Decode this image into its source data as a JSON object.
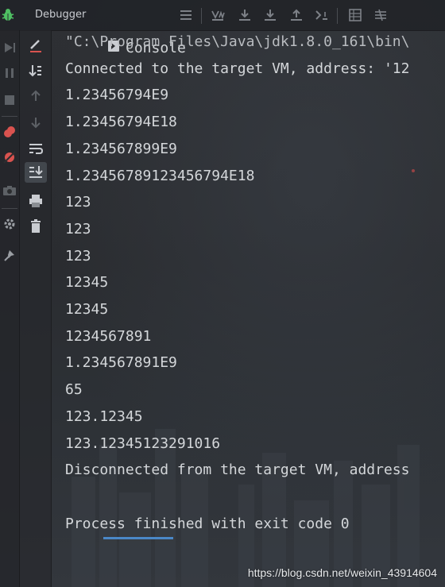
{
  "tabs": {
    "debugger_label": "Debugger",
    "console_label": "Console",
    "active": "Console"
  },
  "toolbar_icons": [
    "menu-icon",
    "show-execution-point-icon",
    "step-over-icon",
    "step-into-icon",
    "step-out-icon",
    "run-to-cursor-icon",
    "evaluate-icon",
    "trace-icon"
  ],
  "left_icons": [
    "rerun-icon",
    "resume-icon",
    "pause-icon",
    "stop-icon",
    "view-breakpoints-icon",
    "mute-breakpoints-icon",
    "camera-icon",
    "settings-icon",
    "pin-icon"
  ],
  "console_icons": [
    "clear-edit-icon",
    "sort-icon",
    "up-icon",
    "down-icon",
    "soft-wrap-icon",
    "scroll-to-end-icon",
    "print-icon",
    "trash-icon"
  ],
  "console": {
    "lines": [
      {
        "text": "\"C:\\Program Files\\Java\\jdk1.8.0_161\\bin\\",
        "kind": "cmd"
      },
      {
        "text": "Connected to the target VM, address: '12",
        "kind": "out"
      },
      {
        "text": "1.23456794E9",
        "kind": "out"
      },
      {
        "text": "1.23456794E18",
        "kind": "out"
      },
      {
        "text": "1.234567899E9",
        "kind": "out"
      },
      {
        "text": "1.2345678912345679 4E18",
        "kind": "out"
      },
      {
        "text": "123",
        "kind": "out"
      },
      {
        "text": "123",
        "kind": "out"
      },
      {
        "text": "123",
        "kind": "out"
      },
      {
        "text": "12345",
        "kind": "out"
      },
      {
        "text": "12345",
        "kind": "out"
      },
      {
        "text": "1234567891",
        "kind": "out"
      },
      {
        "text": "1.234567891E9",
        "kind": "out"
      },
      {
        "text": "65",
        "kind": "out"
      },
      {
        "text": "123.12345",
        "kind": "out"
      },
      {
        "text": "123.12345123291016",
        "kind": "out"
      },
      {
        "text": "Disconnected from the target VM, address",
        "kind": "out"
      },
      {
        "text": "",
        "kind": "out"
      },
      {
        "text": "Process finished with exit code 0",
        "kind": "out"
      }
    ]
  },
  "watermark": "https://blog.csdn.net/weixin_43914604",
  "colors": {
    "accent": "#4a88c7",
    "text": "#d4d7da",
    "bug_green": "#4fbf63",
    "stop_red": "#d9534f"
  }
}
